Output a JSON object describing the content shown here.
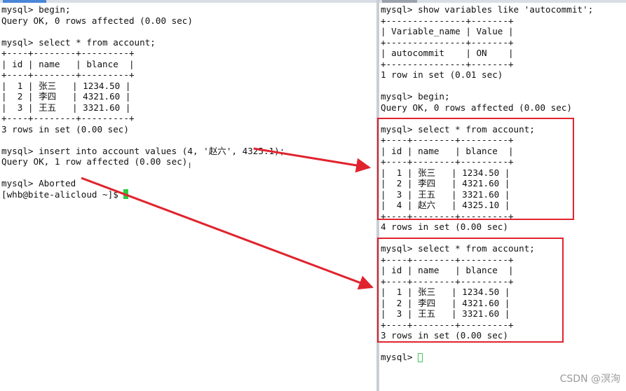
{
  "left_terminal": {
    "lines": [
      "mysql> begin;",
      "Query OK, 0 rows affected (0.00 sec)",
      "",
      "mysql> select * from account;",
      "+----+--------+---------+",
      "| id | name   | blance  |",
      "+----+--------+---------+",
      "|  1 | 张三   | 1234.50 |",
      "|  2 | 李四   | 4321.60 |",
      "|  3 | 王五   | 3321.60 |",
      "+----+--------+---------+",
      "3 rows in set (0.00 sec)",
      "",
      "mysql> insert into account values (4, '赵六', 4325.1);",
      "Query OK, 1 row affected (0.00 sec)",
      "",
      "mysql> Aborted"
    ],
    "shell_prompt": "[whb@bite-alicloud ~]$ "
  },
  "right_terminal": {
    "lines": [
      "mysql> show variables like 'autocommit';",
      "+---------------+-------+",
      "| Variable_name | Value |",
      "+---------------+-------+",
      "| autocommit    | ON    |",
      "+---------------+-------+",
      "1 row in set (0.01 sec)",
      "",
      "mysql> begin;",
      "Query OK, 0 rows affected (0.00 sec)",
      "",
      "mysql> select * from account;",
      "+----+--------+---------+",
      "| id | name   | blance  |",
      "+----+--------+---------+",
      "|  1 | 张三   | 1234.50 |",
      "|  2 | 李四   | 4321.60 |",
      "|  3 | 王五   | 3321.60 |",
      "|  4 | 赵六   | 4325.10 |",
      "+----+--------+---------+",
      "4 rows in set (0.00 sec)",
      "",
      "mysql> select * from account;",
      "+----+--------+---------+",
      "| id | name   | blance  |",
      "+----+--------+---------+",
      "|  1 | 张三   | 1234.50 |",
      "|  2 | 李四   | 4321.60 |",
      "|  3 | 王五   | 3321.60 |",
      "+----+--------+---------+",
      "3 rows in set (0.00 sec)",
      ""
    ],
    "prompt": "mysql> "
  },
  "watermark": "CSDN @溟洵",
  "colors": {
    "highlight": "#e0242e",
    "cursor": "#2ecc40",
    "divider": "#c9ced6"
  }
}
